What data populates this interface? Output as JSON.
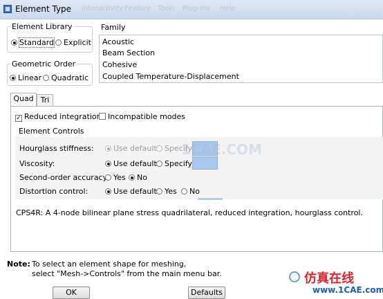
{
  "window": {
    "title": "Element Type"
  },
  "ghost_menu": [
    "Interactivity",
    "Feature",
    "Tools",
    "Plug-ins",
    "Help"
  ],
  "element_library": {
    "label": "Element Library",
    "options": [
      "Standard",
      "Explicit"
    ],
    "selected": "Standard"
  },
  "geometric_order": {
    "label": "Geometric Order",
    "options": [
      "Linear",
      "Quadratic"
    ],
    "selected": "Linear"
  },
  "family": {
    "label": "Family",
    "items": [
      "Acoustic",
      "Beam Section",
      "Cohesive",
      "Coupled Temperature-Displacement"
    ]
  },
  "tabs": [
    "Quad",
    "Tri"
  ],
  "active_tab": "Quad",
  "checkboxes": {
    "reduced_integration": {
      "label": "Reduced integration",
      "checked": true
    },
    "incompatible_modes": {
      "label": "Incompatible modes",
      "checked": false
    }
  },
  "element_controls": {
    "label": "Element Controls",
    "rows": {
      "hourglass": {
        "label": "Hourglass stiffness:",
        "opt1": "Use default",
        "opt2": "Specify"
      },
      "viscosity": {
        "label": "Viscosity:",
        "opt1": "Use default",
        "opt2": "Specify"
      },
      "second_order": {
        "label": "Second-order accuracy:",
        "opt1": "Yes",
        "opt2": "No"
      },
      "distortion": {
        "label": "Distortion control:",
        "opt1": "Use default",
        "opt2": "Yes",
        "opt3": "No"
      }
    }
  },
  "description": "CPS4R:  A 4-node bilinear plane stress quadrilateral, reduced integration, hourglass control.",
  "note": {
    "label": "Note:",
    "line1": "To select an element shape for meshing,",
    "line2": "select \"Mesh->Controls\" from the main menu bar."
  },
  "buttons": {
    "ok": "OK",
    "defaults": "Defaults"
  },
  "watermark": {
    "center": "1CAE.COM",
    "brand": "仿真在线",
    "site": "www.1CAE.com"
  },
  "colors": {
    "titlebar": "#c9d9ee",
    "swatch": "#a9c8ec",
    "watermark_red": "#d6262b",
    "watermark_blue": "#1f5fa8"
  }
}
